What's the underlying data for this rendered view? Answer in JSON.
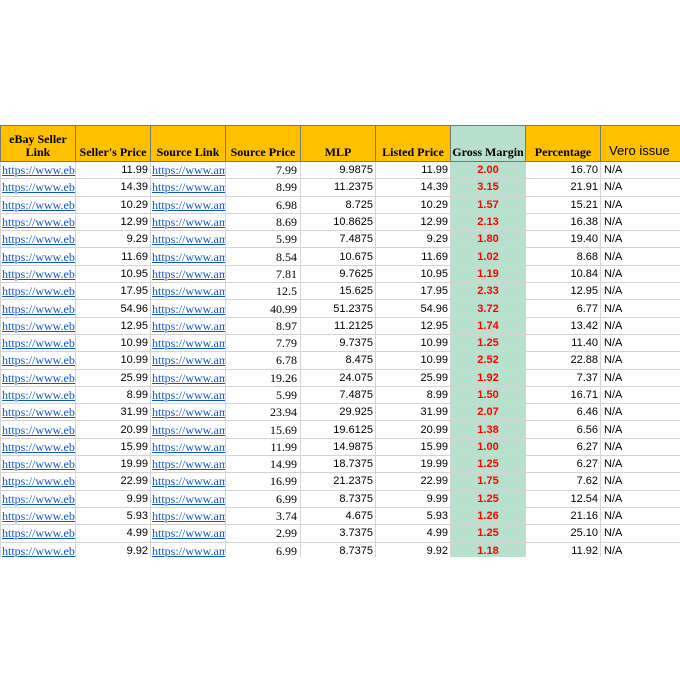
{
  "headers": {
    "ebay_link": "eBay Seller Link",
    "seller_price": "Seller's Price",
    "source_link": "Source Link",
    "source_price": "Source Price",
    "mlp": "MLP",
    "listed_price": "Listed Price",
    "gross_margin": "Gross Margin",
    "percentage": "Percentage",
    "vero": "Vero issue"
  },
  "colors": {
    "header_bg": "#FFC000",
    "margin_bg": "#B7E1CD",
    "margin_text": "#FF0000",
    "link": "#1155CC"
  },
  "rows": [
    {
      "ebay": "https://www.ebay",
      "seller": "11.99",
      "source": "https://www.amazon",
      "src_price": "7.99",
      "mlp": "9.9875",
      "listed": "11.99",
      "gm": "2.00",
      "pct": "16.70",
      "vero": "N/A"
    },
    {
      "ebay": "https://www.ebay",
      "seller": "14.39",
      "source": "https://www.amazon",
      "src_price": "8.99",
      "mlp": "11.2375",
      "listed": "14.39",
      "gm": "3.15",
      "pct": "21.91",
      "vero": "N/A"
    },
    {
      "ebay": "https://www.ebay",
      "seller": "10.29",
      "source": "https://www.amazon",
      "src_price": "6.98",
      "mlp": "8.725",
      "listed": "10.29",
      "gm": "1.57",
      "pct": "15.21",
      "vero": "N/A"
    },
    {
      "ebay": "https://www.ebay",
      "seller": "12.99",
      "source": "https://www.amazon",
      "src_price": "8.69",
      "mlp": "10.8625",
      "listed": "12.99",
      "gm": "2.13",
      "pct": "16.38",
      "vero": "N/A"
    },
    {
      "ebay": "https://www.ebay",
      "seller": "9.29",
      "source": "https://www.amazon",
      "src_price": "5.99",
      "mlp": "7.4875",
      "listed": "9.29",
      "gm": "1.80",
      "pct": "19.40",
      "vero": "N/A"
    },
    {
      "ebay": "https://www.ebay",
      "seller": "11.69",
      "source": "https://www.amazon",
      "src_price": "8.54",
      "mlp": "10.675",
      "listed": "11.69",
      "gm": "1.02",
      "pct": "8.68",
      "vero": "N/A"
    },
    {
      "ebay": "https://www.ebay",
      "seller": "10.95",
      "source": "https://www.amazon",
      "src_price": "7.81",
      "mlp": "9.7625",
      "listed": "10.95",
      "gm": "1.19",
      "pct": "10.84",
      "vero": "N/A"
    },
    {
      "ebay": "https://www.ebay",
      "seller": "17.95",
      "source": "https://www.amazon",
      "src_price": "12.5",
      "mlp": "15.625",
      "listed": "17.95",
      "gm": "2.33",
      "pct": "12.95",
      "vero": "N/A"
    },
    {
      "ebay": "https://www.ebay",
      "seller": "54.96",
      "source": "https://www.amazon",
      "src_price": "40.99",
      "mlp": "51.2375",
      "listed": "54.96",
      "gm": "3.72",
      "pct": "6.77",
      "vero": "N/A"
    },
    {
      "ebay": "https://www.ebay",
      "seller": "12.95",
      "source": "https://www.amazon",
      "src_price": "8.97",
      "mlp": "11.2125",
      "listed": "12.95",
      "gm": "1.74",
      "pct": "13.42",
      "vero": "N/A"
    },
    {
      "ebay": "https://www.ebay",
      "seller": "10.99",
      "source": "https://www.amazon",
      "src_price": "7.79",
      "mlp": "9.7375",
      "listed": "10.99",
      "gm": "1.25",
      "pct": "11.40",
      "vero": "N/A"
    },
    {
      "ebay": "https://www.ebay",
      "seller": "10.99",
      "source": "https://www.amazon",
      "src_price": "6.78",
      "mlp": "8.475",
      "listed": "10.99",
      "gm": "2.52",
      "pct": "22.88",
      "vero": "N/A"
    },
    {
      "ebay": "https://www.ebay",
      "seller": "25.99",
      "source": "https://www.amazon",
      "src_price": "19.26",
      "mlp": "24.075",
      "listed": "25.99",
      "gm": "1.92",
      "pct": "7.37",
      "vero": "N/A"
    },
    {
      "ebay": "https://www.ebay",
      "seller": "8.99",
      "source": "https://www.amazon",
      "src_price": "5.99",
      "mlp": "7.4875",
      "listed": "8.99",
      "gm": "1.50",
      "pct": "16.71",
      "vero": "N/A"
    },
    {
      "ebay": "https://www.ebay",
      "seller": "31.99",
      "source": "https://www.amazon",
      "src_price": "23.94",
      "mlp": "29.925",
      "listed": "31.99",
      "gm": "2.07",
      "pct": "6.46",
      "vero": "N/A"
    },
    {
      "ebay": "https://www.ebay",
      "seller": "20.99",
      "source": "https://www.amazon",
      "src_price": "15.69",
      "mlp": "19.6125",
      "listed": "20.99",
      "gm": "1.38",
      "pct": "6.56",
      "vero": "N/A"
    },
    {
      "ebay": "https://www.ebay",
      "seller": "15.99",
      "source": "https://www.amazon",
      "src_price": "11.99",
      "mlp": "14.9875",
      "listed": "15.99",
      "gm": "1.00",
      "pct": "6.27",
      "vero": "N/A"
    },
    {
      "ebay": "https://www.ebay",
      "seller": "19.99",
      "source": "https://www.amazon",
      "src_price": "14.99",
      "mlp": "18.7375",
      "listed": "19.99",
      "gm": "1.25",
      "pct": "6.27",
      "vero": "N/A"
    },
    {
      "ebay": "https://www.ebay",
      "seller": "22.99",
      "source": "https://www.amazon",
      "src_price": "16.99",
      "mlp": "21.2375",
      "listed": "22.99",
      "gm": "1.75",
      "pct": "7.62",
      "vero": "N/A"
    },
    {
      "ebay": "https://www.ebay",
      "seller": "9.99",
      "source": "https://www.amazon",
      "src_price": "6.99",
      "mlp": "8.7375",
      "listed": "9.99",
      "gm": "1.25",
      "pct": "12.54",
      "vero": "N/A"
    },
    {
      "ebay": "https://www.ebay",
      "seller": "5.93",
      "source": "https://www.amazon",
      "src_price": "3.74",
      "mlp": "4.675",
      "listed": "5.93",
      "gm": "1.26",
      "pct": "21.16",
      "vero": "N/A"
    },
    {
      "ebay": "https://www.ebay",
      "seller": "4.99",
      "source": "https://www.amazon",
      "src_price": "2.99",
      "mlp": "3.7375",
      "listed": "4.99",
      "gm": "1.25",
      "pct": "25.10",
      "vero": "N/A"
    },
    {
      "ebay": "https://www.ebay",
      "seller": "9.92",
      "source": "https://www.amazon",
      "src_price": "6.99",
      "mlp": "8.7375",
      "listed": "9.92",
      "gm": "1.18",
      "pct": "11.92",
      "vero": "N/A"
    }
  ]
}
